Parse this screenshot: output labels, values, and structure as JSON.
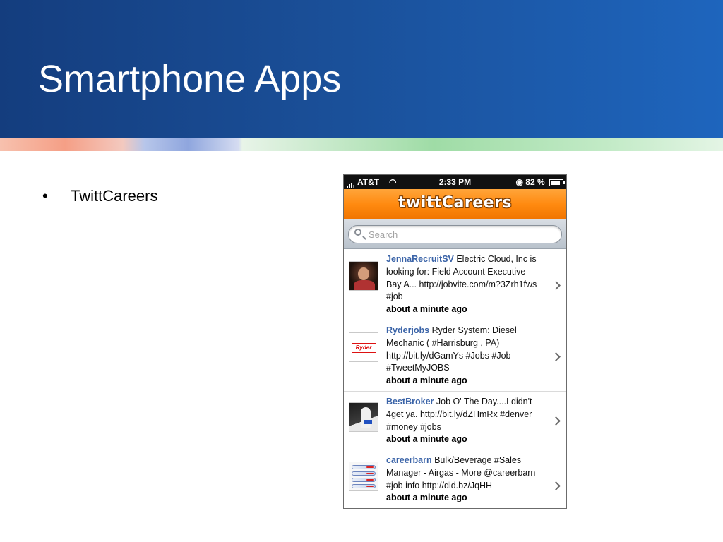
{
  "slide": {
    "title": "Smartphone Apps",
    "bullet_marker": "•",
    "bullets": [
      "TwittCareers"
    ]
  },
  "phone": {
    "status_bar": {
      "carrier": "AT&T",
      "time": "2:33 PM",
      "battery": "82 %"
    },
    "app": {
      "logo_text": "twittCareers"
    },
    "search": {
      "placeholder": "Search"
    },
    "tweets": [
      {
        "user": "JennaRecruitSV",
        "text": " Electric Cloud, Inc is looking for: Field Account Executive - Bay A... http://jobvite.com/m?3Zrh1fws #job",
        "time": "about a minute ago",
        "avatar": "woman-photo"
      },
      {
        "user": "Ryderjobs",
        "text": " Ryder System: Diesel Mechanic ( #Harrisburg , PA) http://bit.ly/dGamYs  #Jobs #Job #TweetMyJOBS",
        "time": "about a minute ago",
        "avatar": "ryder-logo",
        "avatar_text": "Ryder"
      },
      {
        "user": "BestBroker",
        "text": " Job O' The Day....I didn't 4get ya. http://bit.ly/dZHmRx #denver #money #jobs",
        "time": "about a minute ago",
        "avatar": "broker-photo"
      },
      {
        "user": "careerbarn",
        "text": " Bulk/Beverage #Sales Manager - Airgas - More @careerbarn #job info http://dld.bz/JqHH",
        "time": "about a minute ago",
        "avatar": "careerbarn-logo"
      }
    ]
  }
}
